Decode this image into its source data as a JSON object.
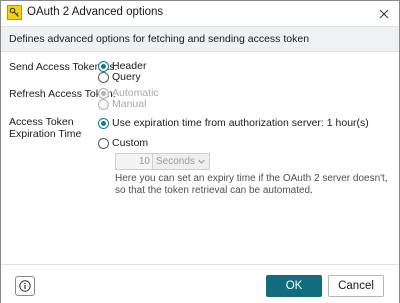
{
  "window": {
    "title": "OAuth 2 Advanced options",
    "app_icon": "key-icon",
    "close_glyph": "✕"
  },
  "description": "Defines advanced options for fetching and sending access token",
  "send_access_token": {
    "label": "Send Access Token as:",
    "options": [
      {
        "label": "Header",
        "checked": true,
        "disabled": false
      },
      {
        "label": "Query",
        "checked": false,
        "disabled": false
      }
    ]
  },
  "refresh_access_token": {
    "label": "Refresh Access Token:",
    "options": [
      {
        "label": "Automatic",
        "checked": true,
        "disabled": true
      },
      {
        "label": "Manual",
        "checked": false,
        "disabled": true
      }
    ]
  },
  "expiration": {
    "label_line1": "Access Token",
    "label_line2": "Expiration Time",
    "use_server_label": "Use expiration time from authorization server: 1 hour(s)",
    "custom_label": "Custom",
    "custom_value": "10",
    "custom_unit": "Seconds",
    "hint_line1": "Here you can set an expiry time if the OAuth 2 server doesn't,",
    "hint_line2": "so that the token retrieval can be automated."
  },
  "footer": {
    "info_icon": "info-icon",
    "ok_label": "OK",
    "cancel_label": "Cancel"
  },
  "colors": {
    "accent": "#116d7d",
    "desc_bar_bg": "#eef0f2",
    "app_icon_bg": "#f3d11a"
  }
}
